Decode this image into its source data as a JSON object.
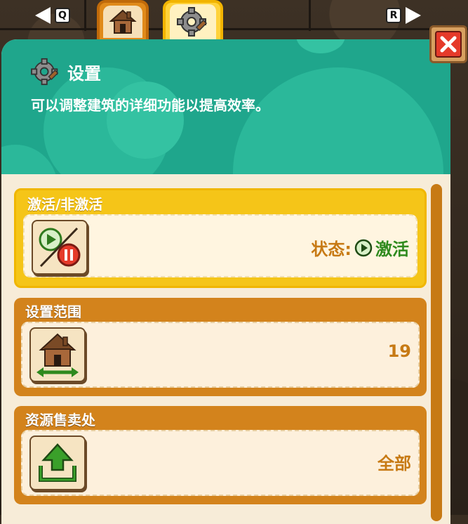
{
  "nav": {
    "prev_key": "Q",
    "next_key": "R"
  },
  "tabs": [
    {
      "icon": "house-icon",
      "selected": false
    },
    {
      "icon": "gear-icon",
      "selected": true
    }
  ],
  "header": {
    "title": "设置",
    "description": "可以调整建筑的详细功能以提高效率。"
  },
  "cards": [
    {
      "title": "激活/非激活",
      "icon": "play-pause-icon",
      "status_label": "状态:",
      "status_value": "激活",
      "active": true
    },
    {
      "title": "设置范围",
      "icon": "house-range-icon",
      "value": "19"
    },
    {
      "title": "资源售卖处",
      "icon": "upload-icon",
      "value": "全部"
    }
  ],
  "colors": {
    "header_teal": "#1fa68c",
    "card_orange": "#d3831c",
    "card_active_yellow": "#f5c518",
    "value_orange": "#c77a14",
    "status_green": "#2f8a1e",
    "close_red": "#e53a2a"
  }
}
